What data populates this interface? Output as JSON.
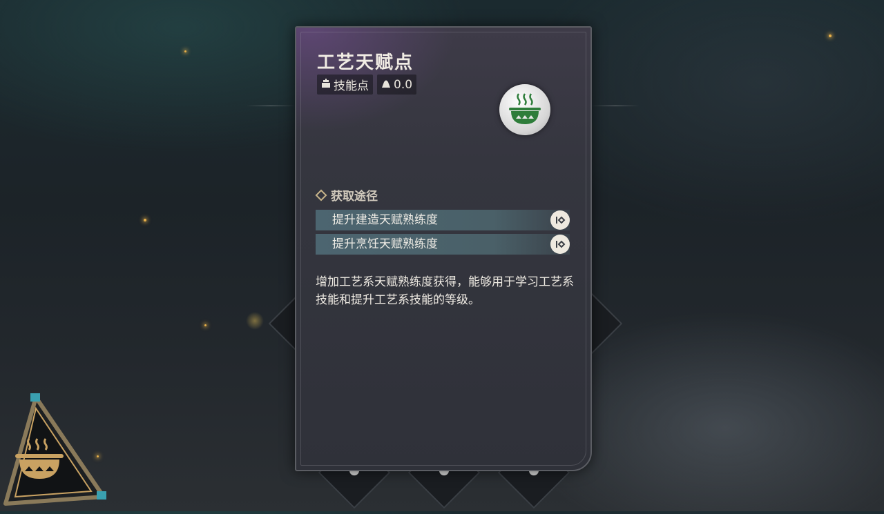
{
  "panel": {
    "title": "工艺天赋点",
    "tag_type": "技能点",
    "tag_weight": "0.0",
    "icon": "cooking-pot-icon",
    "source_heading": "获取途径",
    "routes": [
      {
        "label": "提升建造天赋熟练度"
      },
      {
        "label": "提升烹饪天赋熟练度"
      }
    ],
    "description": "增加工艺系天赋熟练度获得，能够用于学习工艺系技能和提升工艺系技能的等级。"
  },
  "colors": {
    "accent_green": "#2e7d3a",
    "route_bg": "#4c6570",
    "emblem_gold": "#c9a262"
  }
}
